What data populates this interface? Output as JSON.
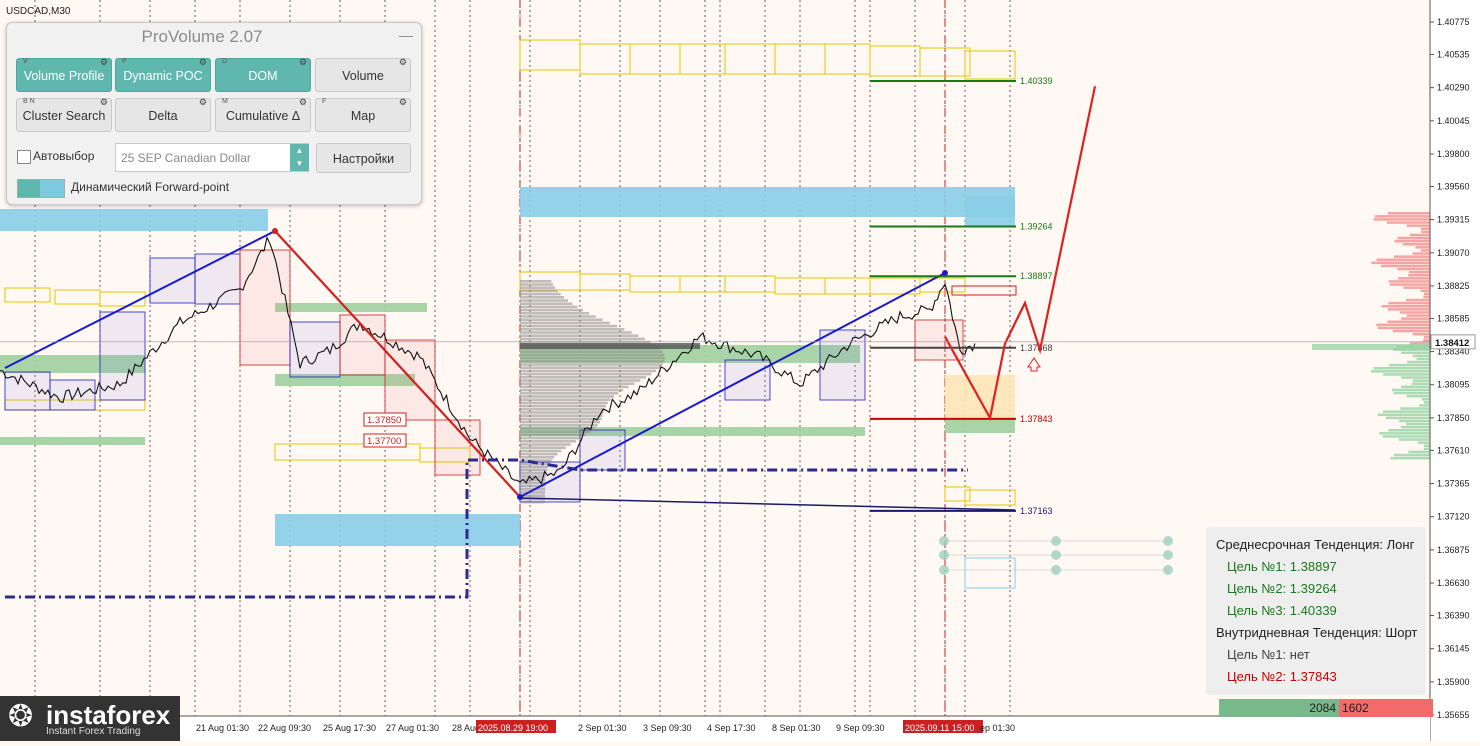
{
  "chart_data": {
    "type": "line",
    "symbol": "USDCAD,M30",
    "ylim": [
      1.35655,
      1.40775
    ],
    "y_ticks": [
      1.40775,
      1.40535,
      1.4029,
      1.40045,
      1.398,
      1.3956,
      1.39315,
      1.3907,
      1.38825,
      1.38585,
      1.3834,
      1.38095,
      1.3785,
      1.3761,
      1.37365,
      1.3712,
      1.36875,
      1.3663,
      1.3639,
      1.36145,
      1.359,
      1.35655
    ],
    "current_price": "1.38412",
    "x_labels": [
      "20 Aug",
      "21 Aug 01:30",
      "22 Aug 09:30",
      "25 Aug 17:30",
      "27 Aug 01:30",
      "28 Aug",
      "2025.08.29 19:00",
      "2 Sep 01:30",
      "3 Sep 09:30",
      "4 Sep 17:30",
      "8 Sep 01:30",
      "9 Sep 09:30",
      "2025.09.11 15:00",
      "ep 01:30"
    ],
    "highlighted_x_labels": [
      "2025.08.29 19:00",
      "2025.09.11 15:00"
    ],
    "levels": [
      {
        "label": "1.40339",
        "value": 1.40339,
        "color": "#1a7a1a"
      },
      {
        "label": "1.39264",
        "value": 1.39264,
        "color": "#1a7a1a"
      },
      {
        "label": "1.38897",
        "value": 1.38897,
        "color": "#1a7a1a"
      },
      {
        "label": "1.37843",
        "value": 1.37843,
        "color": "#cc0000"
      },
      {
        "label": "1.37163",
        "value": 1.37163,
        "color": "#1a1a6a"
      },
      {
        "label": "1.37868",
        "value": 1.38368,
        "color": "#444444"
      }
    ],
    "boxed_levels": [
      "1.37850",
      "1.37700"
    ],
    "series": [
      {
        "x": [
          0,
          60,
          120,
          180,
          240,
          270,
          300,
          330,
          360,
          420,
          470,
          520,
          560,
          600,
          640,
          700,
          760,
          800,
          850,
          900,
          930,
          945,
          960,
          975
        ],
        "values": [
          1.382,
          1.38,
          1.381,
          1.3855,
          1.388,
          1.3918,
          1.3825,
          1.3835,
          1.3855,
          1.383,
          1.377,
          1.3735,
          1.3745,
          1.379,
          1.3805,
          1.3845,
          1.383,
          1.381,
          1.384,
          1.386,
          1.3865,
          1.3886,
          1.3835,
          1.384
        ]
      }
    ],
    "projection": {
      "color": "#e02020",
      "x": [
        945,
        990,
        1005,
        1025,
        1040,
        1095
      ],
      "values": [
        1.3845,
        1.3785,
        1.384,
        1.387,
        1.3835,
        1.403
      ]
    },
    "trendlines": {
      "color": "#1a1acc"
    }
  },
  "panel": {
    "title": "ProVolume 2.07",
    "minimize": "—",
    "buttons": [
      {
        "key": "V",
        "label": "Volume Profile",
        "active": true
      },
      {
        "key": "P",
        "label": "Dynamic POC",
        "active": true
      },
      {
        "key": "D",
        "label": "DOM",
        "active": true
      },
      {
        "key": "",
        "label": "Volume",
        "active": false
      },
      {
        "key": "B N",
        "label": "Cluster Search",
        "active": false
      },
      {
        "key": "",
        "label": "Delta",
        "active": false
      },
      {
        "key": "M",
        "label": "Cumulative Δ",
        "active": false
      },
      {
        "key": "F",
        "label": "Map",
        "active": false
      }
    ],
    "gear_icon": "gear-icon",
    "auto_select_label": "Автовыбор",
    "contract_value": "25 SEP Canadian Dollar",
    "settings_label": "Настройки",
    "forward_point_label": "Динамический Forward-point"
  },
  "info_box": {
    "mid_trend": "Среднесрочная Тенденция: Лонг",
    "target1": "Цель №1: 1.38897",
    "target2": "Цель №2: 1.39264",
    "target3": "Цель №3: 1.40339",
    "intraday_trend": "Внутридневная Тенденция: Шорт",
    "itarget1": "Цель №1: нет",
    "itarget2": "Цель №2: 1.37843",
    "colors": {
      "green": "#1a7a1a",
      "red": "#cc0000"
    }
  },
  "counter": {
    "left": "2084",
    "right": "1602"
  },
  "logo": {
    "name": "instaforex",
    "tagline": "Instant Forex Trading"
  }
}
